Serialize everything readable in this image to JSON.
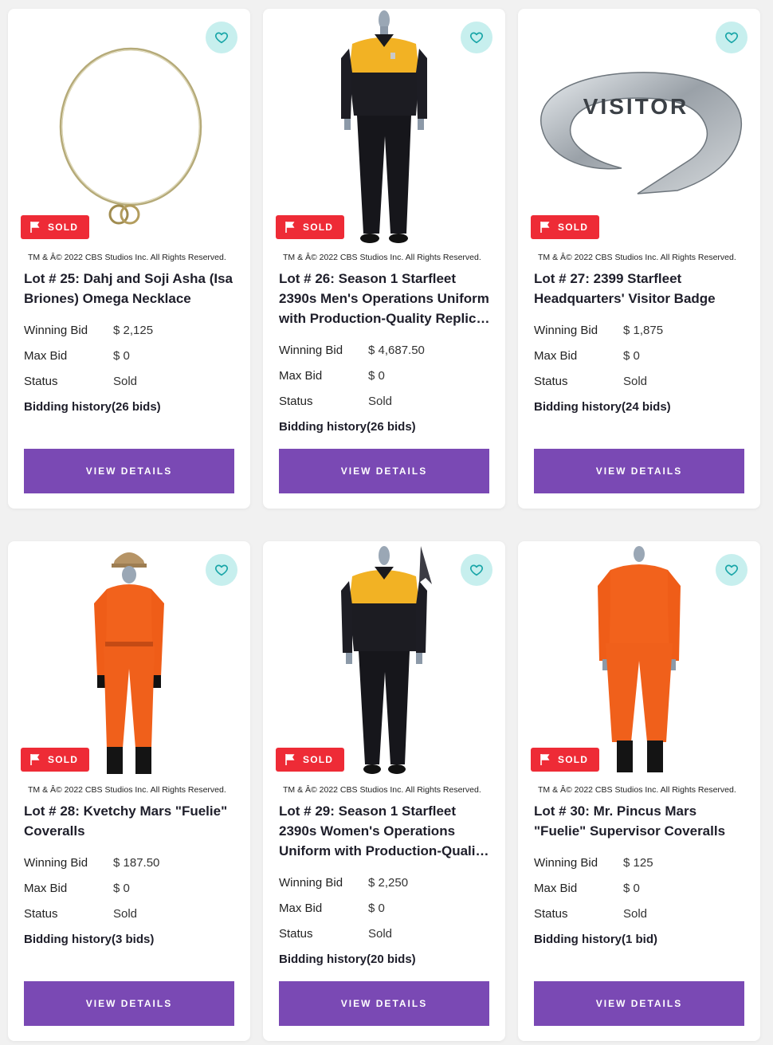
{
  "cards": [
    {
      "title": "Lot # 25: Dahj and Soji Asha (Isa Briones) Omega Necklace",
      "copyright": "TM & Â© 2022 CBS Studios Inc. All Rights Reserved.",
      "sold_label": "SOLD",
      "winning_bid_label": "Winning Bid",
      "winning_bid": "$ 2,125",
      "max_bid_label": "Max Bid",
      "max_bid": "$ 0",
      "status_label": "Status",
      "status": "Sold",
      "bidding_history": "Bidding history(26 bids)",
      "button": "VIEW DETAILS"
    },
    {
      "title": "Lot # 26: Season 1 Starfleet 2390s Men's Operations Uniform with Production-Quality Replica Combadge",
      "copyright": "TM & Â© 2022 CBS Studios Inc. All Rights Reserved.",
      "sold_label": "SOLD",
      "winning_bid_label": "Winning Bid",
      "winning_bid": "$ 4,687.50",
      "max_bid_label": "Max Bid",
      "max_bid": "$ 0",
      "status_label": "Status",
      "status": "Sold",
      "bidding_history": "Bidding history(26 bids)",
      "button": "VIEW DETAILS"
    },
    {
      "title": "Lot # 27: 2399 Starfleet Headquarters' Visitor Badge",
      "copyright": "TM & Â© 2022 CBS Studios Inc. All Rights Reserved.",
      "sold_label": "SOLD",
      "badge_text": "VISITOR",
      "winning_bid_label": "Winning Bid",
      "winning_bid": "$ 1,875",
      "max_bid_label": "Max Bid",
      "max_bid": "$ 0",
      "status_label": "Status",
      "status": "Sold",
      "bidding_history": "Bidding history(24 bids)",
      "button": "VIEW DETAILS"
    },
    {
      "title": "Lot # 28: Kvetchy Mars \"Fuelie\" Coveralls",
      "copyright": "TM & Â© 2022 CBS Studios Inc. All Rights Reserved.",
      "sold_label": "SOLD",
      "winning_bid_label": "Winning Bid",
      "winning_bid": "$ 187.50",
      "max_bid_label": "Max Bid",
      "max_bid": "$ 0",
      "status_label": "Status",
      "status": "Sold",
      "bidding_history": "Bidding history(3 bids)",
      "button": "VIEW DETAILS"
    },
    {
      "title": "Lot # 29: Season 1 Starfleet 2390s Women's Operations Uniform with Production-Quality Replica Combadge",
      "copyright": "TM & Â© 2022 CBS Studios Inc. All Rights Reserved.",
      "sold_label": "SOLD",
      "winning_bid_label": "Winning Bid",
      "winning_bid": "$ 2,250",
      "max_bid_label": "Max Bid",
      "max_bid": "$ 0",
      "status_label": "Status",
      "status": "Sold",
      "bidding_history": "Bidding history(20 bids)",
      "button": "VIEW DETAILS"
    },
    {
      "title": "Lot # 30: Mr. Pincus Mars \"Fuelie\" Supervisor Coveralls",
      "copyright": "TM & Â© 2022 CBS Studios Inc. All Rights Reserved.",
      "sold_label": "SOLD",
      "winning_bid_label": "Winning Bid",
      "winning_bid": "$ 125",
      "max_bid_label": "Max Bid",
      "max_bid": "$ 0",
      "status_label": "Status",
      "status": "Sold",
      "bidding_history": "Bidding history(1 bid)",
      "button": "VIEW DETAILS"
    }
  ],
  "colors": {
    "sold_badge": "#ee2b36",
    "button": "#7a49b4",
    "favorite_bg": "#c7efee",
    "favorite_icon": "#1aa6a8"
  },
  "icons": {
    "favorite": "heart-icon",
    "sold": "flag-icon"
  }
}
